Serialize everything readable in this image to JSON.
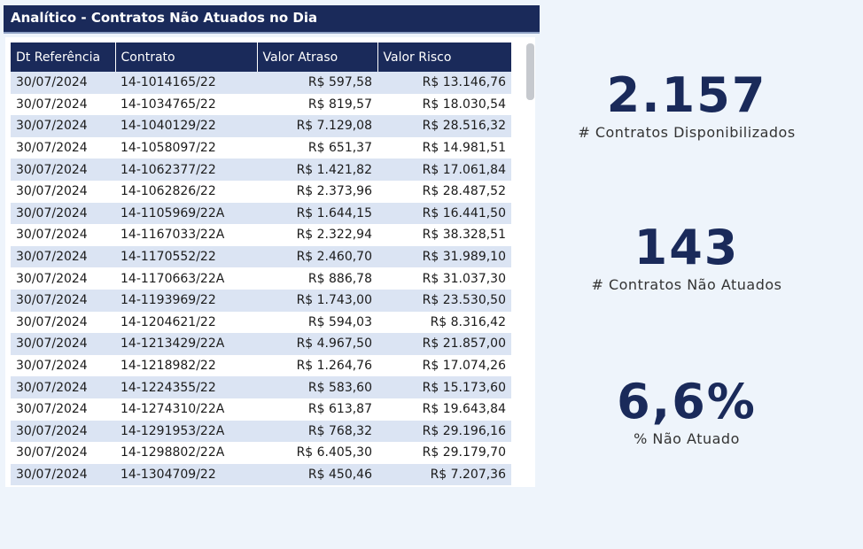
{
  "title": "Analítico - Contratos Não Atuados no Dia",
  "table": {
    "headers": [
      "Dt Referência",
      "Contrato",
      "Valor Atraso",
      "Valor Risco"
    ],
    "rows": [
      [
        "30/07/2024",
        "14-1014165/22",
        "R$ 597,58",
        "R$ 13.146,76"
      ],
      [
        "30/07/2024",
        "14-1034765/22",
        "R$ 819,57",
        "R$ 18.030,54"
      ],
      [
        "30/07/2024",
        "14-1040129/22",
        "R$ 7.129,08",
        "R$ 28.516,32"
      ],
      [
        "30/07/2024",
        "14-1058097/22",
        "R$ 651,37",
        "R$ 14.981,51"
      ],
      [
        "30/07/2024",
        "14-1062377/22",
        "R$ 1.421,82",
        "R$ 17.061,84"
      ],
      [
        "30/07/2024",
        "14-1062826/22",
        "R$ 2.373,96",
        "R$ 28.487,52"
      ],
      [
        "30/07/2024",
        "14-1105969/22A",
        "R$ 1.644,15",
        "R$ 16.441,50"
      ],
      [
        "30/07/2024",
        "14-1167033/22A",
        "R$ 2.322,94",
        "R$ 38.328,51"
      ],
      [
        "30/07/2024",
        "14-1170552/22",
        "R$ 2.460,70",
        "R$ 31.989,10"
      ],
      [
        "30/07/2024",
        "14-1170663/22A",
        "R$ 886,78",
        "R$ 31.037,30"
      ],
      [
        "30/07/2024",
        "14-1193969/22",
        "R$ 1.743,00",
        "R$ 23.530,50"
      ],
      [
        "30/07/2024",
        "14-1204621/22",
        "R$ 594,03",
        "R$ 8.316,42"
      ],
      [
        "30/07/2024",
        "14-1213429/22A",
        "R$ 4.967,50",
        "R$ 21.857,00"
      ],
      [
        "30/07/2024",
        "14-1218982/22",
        "R$ 1.264,76",
        "R$ 17.074,26"
      ],
      [
        "30/07/2024",
        "14-1224355/22",
        "R$ 583,60",
        "R$ 15.173,60"
      ],
      [
        "30/07/2024",
        "14-1274310/22A",
        "R$ 613,87",
        "R$ 19.643,84"
      ],
      [
        "30/07/2024",
        "14-1291953/22A",
        "R$ 768,32",
        "R$ 29.196,16"
      ],
      [
        "30/07/2024",
        "14-1298802/22A",
        "R$ 6.405,30",
        "R$ 29.179,70"
      ],
      [
        "30/07/2024",
        "14-1304709/22",
        "R$ 450,46",
        "R$ 7.207,36"
      ]
    ]
  },
  "kpis": [
    {
      "value": "2.157",
      "label": "# Contratos Disponibilizados"
    },
    {
      "value": "143",
      "label": "# Contratos Não Atuados"
    },
    {
      "value": "6,6%",
      "label": "% Não Atuado"
    }
  ],
  "colors": {
    "header_bg": "#1a2a5a",
    "alt_row": "#dbe4f3",
    "page_bg": "#eef4fb"
  }
}
